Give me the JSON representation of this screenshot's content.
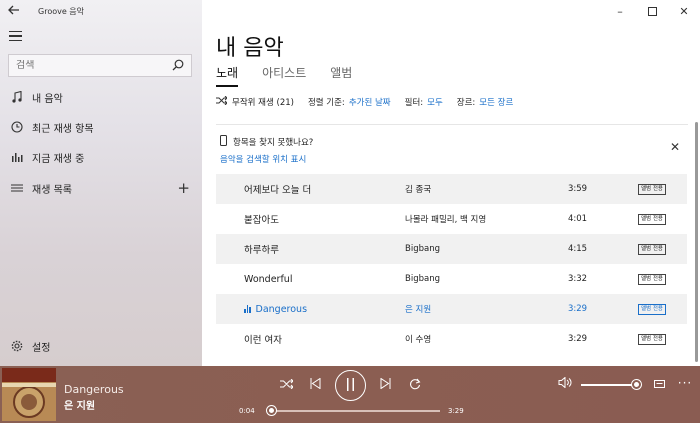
{
  "app": {
    "title": "Groove 음악"
  },
  "sidebar": {
    "search_placeholder": "검색",
    "items": [
      {
        "label": "내 음악",
        "icon": "music-note-icon"
      },
      {
        "label": "최근 재생 항목",
        "icon": "clock-icon"
      },
      {
        "label": "지금 재생 중",
        "icon": "now-playing-bars-icon"
      },
      {
        "label": "재생 목록",
        "icon": "playlist-icon"
      }
    ],
    "settings_label": "설정"
  },
  "main": {
    "title": "내 음악",
    "tabs": [
      {
        "label": "노래",
        "active": true
      },
      {
        "label": "아티스트",
        "active": false
      },
      {
        "label": "앨범",
        "active": false
      }
    ],
    "filters": {
      "shuffle_label": "무작위 재생 (21)",
      "sort_label": "정렬 기준:",
      "sort_value": "추가된 날짜",
      "filter_label": "필터:",
      "filter_value": "모두",
      "genre_label": "장르:",
      "genre_value": "모든 장르"
    },
    "notice": {
      "question": "항목을 찾지 못했나요?",
      "link": "음악을 검색할 위치 표시"
    },
    "songs": [
      {
        "title": "어제보다 오늘 더",
        "artist": "김 종국",
        "duration": "3:59",
        "badge": "앨범 전용"
      },
      {
        "title": "붙잡아도",
        "artist": "나몰라 패밀리, 백 지영",
        "duration": "4:01",
        "badge": "앨범 전용"
      },
      {
        "title": "하루하루",
        "artist": "Bigbang",
        "duration": "4:15",
        "badge": "앨범 전용"
      },
      {
        "title": "Wonderful",
        "artist": "Bigbang",
        "duration": "3:32",
        "badge": "앨범 전용"
      },
      {
        "title": "Dangerous",
        "artist": "은 지원",
        "duration": "3:29",
        "badge": "앨범 전용",
        "playing": true
      },
      {
        "title": "이런 여자",
        "artist": "이 수영",
        "duration": "3:29",
        "badge": "앨범 전용"
      }
    ]
  },
  "player": {
    "title": "Dangerous",
    "artist": "은 지원",
    "elapsed": "0:04",
    "total": "3:29",
    "progress": 0.02,
    "volume": 1.0,
    "album_art_text": "G-ONE & CODE"
  },
  "colors": {
    "accent": "#1a6fc9",
    "player_bg": "#8a5e52"
  }
}
